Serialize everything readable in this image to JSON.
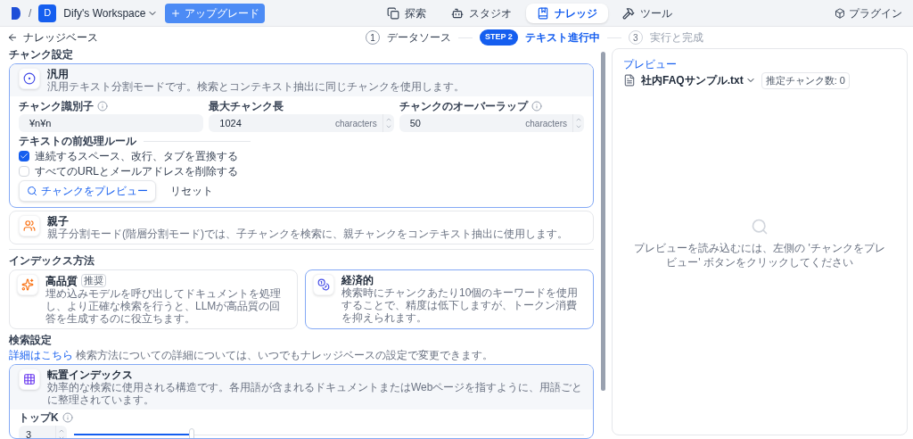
{
  "topbar": {
    "workspace_initial": "D",
    "separator": "/",
    "workspace": "Dify's Workspace",
    "upgrade": "アップグレード",
    "nav": [
      {
        "kind": "explore",
        "label": "探索",
        "selected": false
      },
      {
        "kind": "studio",
        "label": "スタジオ",
        "selected": false
      },
      {
        "kind": "knowledge",
        "label": "ナレッジ",
        "selected": true
      },
      {
        "kind": "tools",
        "label": "ツール",
        "selected": false
      }
    ],
    "plugins": "プラグイン"
  },
  "breadcrumb": {
    "back_label": "ナレッジベース"
  },
  "steps": [
    {
      "marker": "1",
      "label": "データソース",
      "selected": false,
      "disabled": false
    },
    {
      "marker": "STEP 2",
      "label": "テキスト進行中",
      "selected": true,
      "disabled": false
    },
    {
      "marker": "3",
      "label": "実行と完成",
      "selected": false,
      "disabled": true
    }
  ],
  "chunk_settings": {
    "title": "チャンク設定",
    "modes": [
      {
        "kind": "general",
        "title": "汎用",
        "description": "汎用テキスト分割モードです。検索とコンテキスト抽出に同じチャンクを使用します。",
        "selected": true,
        "fields": [
          {
            "label": "チャンク識別子",
            "info": true,
            "value": "¥n¥n"
          },
          {
            "label": "最大チャンク長",
            "info": false,
            "value": "1024",
            "unit": "characters"
          },
          {
            "label": "チャンクのオーバーラップ",
            "info": true,
            "value": "50",
            "unit": "characters"
          }
        ],
        "rules_title": "テキストの前処理ルール",
        "rules": [
          {
            "label": "連続するスペース、改行、タブを置換する",
            "checked": true
          },
          {
            "label": "すべてのURLとメールアドレスを削除する",
            "checked": false
          }
        ],
        "preview_button": "チャンクをプレビュー",
        "reset_button": "リセット"
      },
      {
        "kind": "parent_child",
        "title": "親子",
        "description": "親子分割モード(階層分割モード)では、子チャンクを検索に、親チャンクをコンテキスト抽出に使用します。",
        "selected": false
      }
    ]
  },
  "index_method": {
    "title": "インデックス方法",
    "options": [
      {
        "kind": "quality",
        "title": "高品質",
        "badge": "推奨",
        "description": "埋め込みモデルを呼び出してドキュメントを処理し、より正確な検索を行うと、LLMが高品質の回答を生成するのに役立ちます。",
        "selected": false
      },
      {
        "kind": "economy",
        "title": "経済的",
        "description": "検索時にチャンクあたり10個のキーワードを使用することで、精度は低下しますが、トークン消費を抑えられます。",
        "selected": true
      }
    ]
  },
  "retrieval": {
    "title": "検索設定",
    "link": "詳細はこちら",
    "note": "検索方法についての詳細については、いつでもナレッジベースの設定で変更できます。",
    "method": {
      "title": "転置インデックス",
      "description": "効率的な検索に使用される構造です。各用語が含まれるドキュメントまたはWebページを指すように、用語ごとに整理されています。"
    },
    "top_k": {
      "label": "トップK",
      "value": "3",
      "level": 0.23
    }
  },
  "preview": {
    "label": "プレビュー",
    "file": "社内FAQサンプル.txt",
    "badge": "推定チャンク数: 0",
    "empty_message": "プレビューを読み込むには、左側の 'チャンクをプレビュー' ボタンをクリックしてください"
  }
}
